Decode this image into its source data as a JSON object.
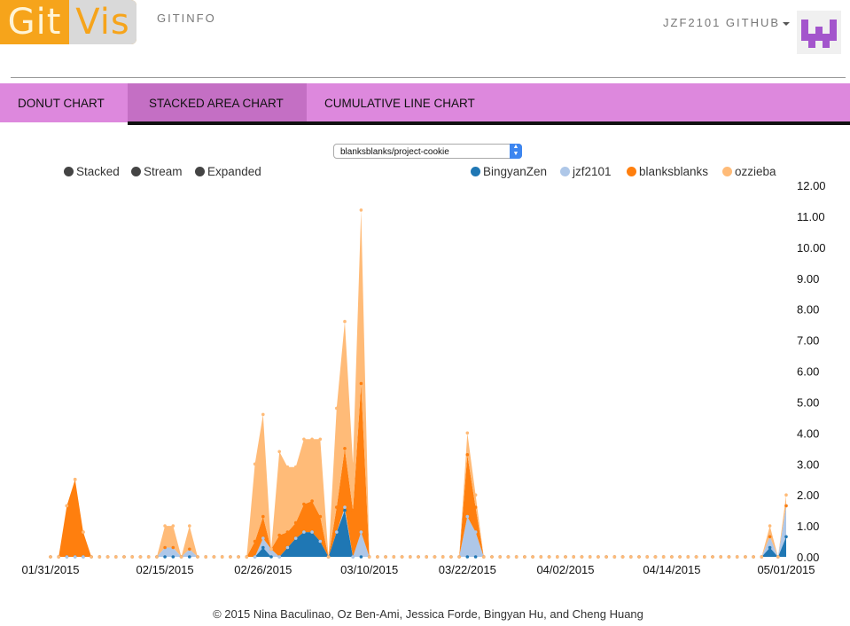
{
  "app": {
    "logo": {
      "part1": "Git",
      "part2": "Vis"
    },
    "brand": "GITINFO",
    "user_menu": "JZF2101 GITHUB"
  },
  "tabs": [
    {
      "label": "DONUT CHART"
    },
    {
      "label": "STACKED AREA CHART"
    },
    {
      "label": "CUMULATIVE LINE CHART"
    }
  ],
  "active_tab": "STACKED AREA CHART",
  "repo_select": {
    "selected": "blanksblanks/project-cookie"
  },
  "modes": [
    {
      "label": "Stacked"
    },
    {
      "label": "Stream"
    },
    {
      "label": "Expanded"
    }
  ],
  "footer": "© 2015 Nina Baculinao, Oz Ben-Ami, Jessica Forde, Bingyan Hu, and Cheng Huang",
  "chart_data": {
    "type": "area",
    "stacked": true,
    "colors": {
      "BingyanZen": "#1f77b4",
      "jzf2101": "#aec7e8",
      "blanksblanks": "#ff7f0e",
      "ozzieba": "#ffbb78"
    },
    "legend_position": "top-right",
    "x_tick_labels": [
      "01/31/2015",
      "02/15/2015",
      "02/26/2015",
      "03/10/2015",
      "03/22/2015",
      "04/02/2015",
      "04/14/2015",
      "05/01/2015"
    ],
    "y_tick_labels": [
      "0.00",
      "1.00",
      "2.00",
      "3.00",
      "4.00",
      "5.00",
      "6.00",
      "7.00",
      "8.00",
      "9.00",
      "10.00",
      "11.00",
      "12.00"
    ],
    "ylim": [
      0,
      12
    ],
    "series": [
      {
        "name": "BingyanZen",
        "points": [
          [
            "2015-02-25",
            0
          ],
          [
            "2015-02-26",
            0.3
          ],
          [
            "2015-02-27",
            0
          ],
          [
            "2015-03-01",
            0.3
          ],
          [
            "2015-03-02",
            0.6
          ],
          [
            "2015-03-03",
            0.8
          ],
          [
            "2015-03-04",
            0.8
          ],
          [
            "2015-03-05",
            0.5
          ],
          [
            "2015-03-06",
            0
          ],
          [
            "2015-03-07",
            0.8
          ],
          [
            "2015-03-08",
            1.5
          ],
          [
            "2015-03-09",
            0
          ],
          [
            "2015-04-28",
            0
          ],
          [
            "2015-04-29",
            0.3
          ],
          [
            "2015-04-30",
            0
          ],
          [
            "2015-05-01",
            0.65
          ],
          [
            "2015-05-02",
            0
          ]
        ]
      },
      {
        "name": "jzf2101",
        "points": [
          [
            "2015-02-13",
            0
          ],
          [
            "2015-02-14",
            0.3
          ],
          [
            "2015-02-15",
            0.3
          ],
          [
            "2015-02-16",
            0
          ],
          [
            "2015-02-17",
            0.25
          ],
          [
            "2015-02-18",
            0
          ],
          [
            "2015-02-25",
            0
          ],
          [
            "2015-02-26",
            0.3
          ],
          [
            "2015-02-27",
            0.25
          ],
          [
            "2015-03-08",
            0.1
          ],
          [
            "2015-03-10",
            0.8
          ],
          [
            "2015-03-11",
            0
          ],
          [
            "2015-03-22",
            0
          ],
          [
            "2015-03-23",
            1.3
          ],
          [
            "2015-03-24",
            0.8
          ],
          [
            "2015-03-25",
            0
          ],
          [
            "2015-04-28",
            0
          ],
          [
            "2015-04-29",
            0.35
          ],
          [
            "2015-04-30",
            0
          ],
          [
            "2015-05-01",
            1.0
          ],
          [
            "2015-05-02",
            0
          ]
        ]
      },
      {
        "name": "blanksblanks",
        "points": [
          [
            "2015-02-01",
            0
          ],
          [
            "2015-02-02",
            1.65
          ],
          [
            "2015-02-03",
            2.5
          ],
          [
            "2015-02-04",
            0.8
          ],
          [
            "2015-02-05",
            0
          ],
          [
            "2015-02-24",
            0
          ],
          [
            "2015-02-25",
            0.5
          ],
          [
            "2015-02-26",
            0.7
          ],
          [
            "2015-02-27",
            0
          ],
          [
            "2015-02-28",
            0.7
          ],
          [
            "2015-03-01",
            0.5
          ],
          [
            "2015-03-02",
            0.5
          ],
          [
            "2015-03-03",
            0.9
          ],
          [
            "2015-03-04",
            1.0
          ],
          [
            "2015-03-05",
            0.8
          ],
          [
            "2015-03-06",
            0
          ],
          [
            "2015-03-07",
            0.8
          ],
          [
            "2015-03-08",
            1.9
          ],
          [
            "2015-03-09",
            1.5
          ],
          [
            "2015-03-10",
            4.8
          ],
          [
            "2015-03-11",
            0
          ],
          [
            "2015-03-22",
            0
          ],
          [
            "2015-03-23",
            2.0
          ],
          [
            "2015-03-24",
            0.8
          ],
          [
            "2015-03-25",
            0
          ]
        ]
      },
      {
        "name": "ozzieba",
        "points": [
          [
            "2015-02-13",
            0
          ],
          [
            "2015-02-14",
            0.7
          ],
          [
            "2015-02-15",
            0.7
          ],
          [
            "2015-02-16",
            0
          ],
          [
            "2015-02-17",
            0.75
          ],
          [
            "2015-02-18",
            0
          ],
          [
            "2015-02-24",
            0
          ],
          [
            "2015-02-25",
            2.5
          ],
          [
            "2015-02-26",
            3.3
          ],
          [
            "2015-02-27",
            0
          ],
          [
            "2015-02-28",
            2.7
          ],
          [
            "2015-03-01",
            2.1
          ],
          [
            "2015-03-02",
            1.8
          ],
          [
            "2015-03-03",
            2.1
          ],
          [
            "2015-03-04",
            2.0
          ],
          [
            "2015-03-05",
            2.5
          ],
          [
            "2015-03-06",
            0
          ],
          [
            "2015-03-07",
            3.2
          ],
          [
            "2015-03-08",
            4.1
          ],
          [
            "2015-03-09",
            1.5
          ],
          [
            "2015-03-10",
            5.6
          ],
          [
            "2015-03-11",
            0
          ],
          [
            "2015-03-22",
            0
          ],
          [
            "2015-03-23",
            0.7
          ],
          [
            "2015-03-24",
            0.4
          ],
          [
            "2015-03-25",
            0
          ],
          [
            "2015-04-28",
            0
          ],
          [
            "2015-04-29",
            0.35
          ],
          [
            "2015-04-30",
            0
          ],
          [
            "2015-05-01",
            0.35
          ],
          [
            "2015-05-02",
            0
          ]
        ]
      }
    ]
  }
}
